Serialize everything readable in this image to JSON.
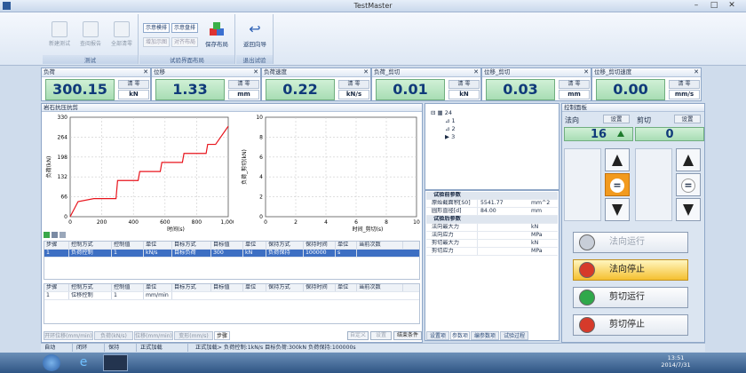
{
  "window": {
    "title": "TestMaster"
  },
  "ribbon": {
    "groups": [
      {
        "caption": "测试",
        "buttons": [
          "新建测试",
          "查阅报告",
          "全部清零"
        ]
      },
      {
        "caption": "试验界面布局",
        "small": [
          "示意模排",
          "示意盘排",
          "增加示图",
          "对齐布局"
        ],
        "big": "保存布局"
      },
      {
        "caption": "退出试验",
        "big": "返回向导"
      }
    ]
  },
  "cards": [
    {
      "label": "负荷",
      "value": "300.15",
      "zero": "清 零",
      "unit": "kN"
    },
    {
      "label": "位移",
      "value": "1.33",
      "zero": "清 零",
      "unit": "mm"
    },
    {
      "label": "负荷速度",
      "value": "0.22",
      "zero": "清 零",
      "unit": "kN/s"
    },
    {
      "label": "负荷_剪切",
      "value": "0.01",
      "zero": "清 零",
      "unit": "kN"
    },
    {
      "label": "位移_剪切",
      "value": "0.03",
      "zero": "清 零",
      "unit": "mm"
    },
    {
      "label": "位移_剪切速度",
      "value": "0.00",
      "zero": "清 零",
      "unit": "mm/s"
    }
  ],
  "main": {
    "title": "岩石抗压抗剪",
    "table1": {
      "headers": [
        "步骤",
        "控制方式",
        "控制值",
        "单位",
        "目标方式",
        "目标值",
        "单位",
        "保持方式",
        "保持时间",
        "单位",
        "当前次数"
      ],
      "rows": [
        [
          "1",
          "负荷控制",
          "1",
          "kN/s",
          "目标负荷",
          "300",
          "kN",
          "负荷保持",
          "100000",
          "s",
          ""
        ]
      ]
    },
    "table2": {
      "headers": [
        "步骤",
        "控制方式",
        "控制值",
        "单位",
        "目标方式",
        "目标值",
        "单位",
        "保持方式",
        "保持时间",
        "单位",
        "当前次数"
      ],
      "rows": [
        [
          "1",
          "位移控制",
          "1",
          "mm/min",
          "",
          "",
          "",
          "",
          "",
          "",
          ""
        ]
      ]
    },
    "bottom_tabs": [
      "开环位移(mm/min)",
      "负荷(kN/s)",
      "位移(mm/min)",
      "变形(mm/s)",
      "步骤"
    ],
    "bottom_buttons": [
      "自定义",
      "设置",
      "结束条件"
    ]
  },
  "tree": {
    "root": "24",
    "items": [
      "1",
      "2",
      "3"
    ]
  },
  "props": {
    "cat1": "试验前参数",
    "rows1": [
      [
        "原始截面积[S0]",
        "5541.77",
        "mm^2"
      ],
      [
        "圆形直径[d]",
        "84.00",
        "mm"
      ]
    ],
    "cat2": "试验后参数",
    "rows2": [
      [
        "法向最大力",
        "",
        "kN"
      ],
      [
        "法向应力",
        "",
        "MPa"
      ],
      [
        "剪切最大力",
        "",
        "kN"
      ],
      [
        "剪切应力",
        "",
        "MPa"
      ]
    ],
    "tabs": [
      "设置项",
      "参数项",
      "编参数项",
      "试验过程"
    ]
  },
  "control": {
    "title": "控制面板",
    "normal_label": "法向",
    "shear_label": "剪切",
    "set_label": "设置",
    "normal_value": "16",
    "shear_value": "0",
    "buttons": [
      {
        "label": "法向运行",
        "color": "#c8ced8"
      },
      {
        "label": "法向停止",
        "color": "#d63a2a"
      },
      {
        "label": "剪切运行",
        "color": "#2fa84a"
      },
      {
        "label": "剪切停止",
        "color": "#d63a2a"
      }
    ]
  },
  "status": {
    "items": [
      "自动",
      "闭环",
      "保持",
      "正式加载"
    ],
    "message": "正式加载> 负荷控制:1kN/s 目标负荷:300kN 负荷保持:100000s"
  },
  "taskbar": {
    "time": "13:51",
    "date": "2014/7/31"
  },
  "chart_data": [
    {
      "type": "line",
      "title": "",
      "xlabel": "时间(s)",
      "ylabel": "负荷(kN)",
      "xlim": [
        0,
        1000
      ],
      "ylim": [
        0,
        330
      ],
      "xticks": [
        "0",
        "200",
        "400",
        "600",
        "800",
        "1,000"
      ],
      "yticks": [
        "0",
        "66",
        "132",
        "198",
        "264",
        "330"
      ],
      "x": [
        0,
        50,
        150,
        160,
        290,
        300,
        430,
        440,
        570,
        580,
        710,
        720,
        860,
        870,
        920,
        1000
      ],
      "y": [
        0,
        50,
        60,
        60,
        60,
        120,
        120,
        150,
        150,
        180,
        180,
        210,
        210,
        240,
        240,
        300
      ]
    },
    {
      "type": "line",
      "title": "",
      "xlabel": "时间_剪切(s)",
      "ylabel": "负荷_剪切(kN)",
      "xlim": [
        0,
        10
      ],
      "ylim": [
        0,
        10
      ],
      "xticks": [
        "0",
        "2",
        "4",
        "6",
        "8",
        "10"
      ],
      "yticks": [
        "0",
        "2",
        "4",
        "6",
        "8",
        "10"
      ],
      "x": [],
      "y": []
    }
  ]
}
